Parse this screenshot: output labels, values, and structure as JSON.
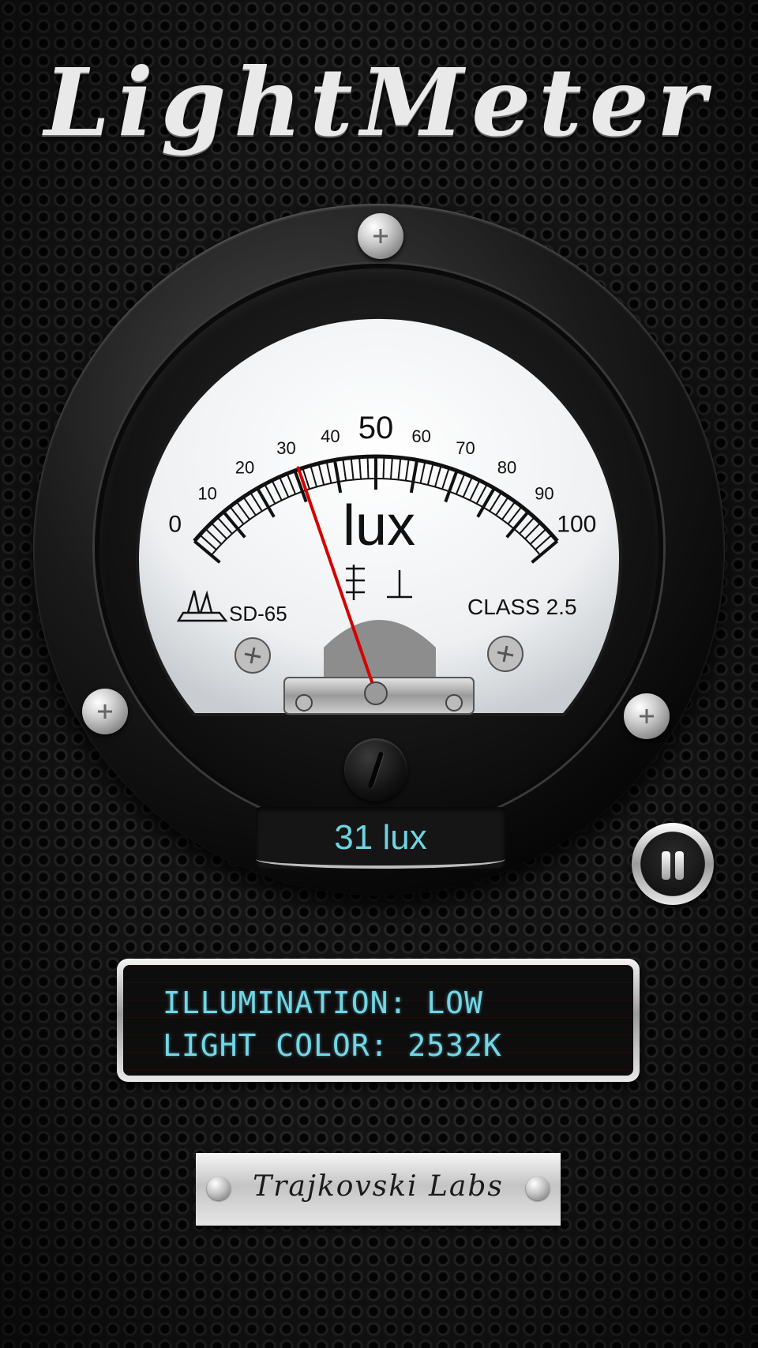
{
  "app": {
    "title": "LightMeter"
  },
  "gauge": {
    "scale_labels": [
      "0",
      "10",
      "20",
      "30",
      "40",
      "50",
      "60",
      "70",
      "80",
      "90",
      "100"
    ],
    "unit_label": "lux",
    "model_label": "SD-65",
    "class_label": "CLASS 2.5",
    "needle_value": 31,
    "scale_min": 0,
    "scale_max": 100,
    "needle_color": "#d40000"
  },
  "readout": {
    "value_text": "31 lux",
    "color": "#6fd3e0"
  },
  "controls": {
    "pause_icon": "pause-icon"
  },
  "info_panel": {
    "illumination_line": "ILLUMINATION: LOW",
    "light_color_line": "LIGHT COLOR: 2532K",
    "text_color": "#74d6e6"
  },
  "brand": {
    "name": "Trajkovski Labs"
  }
}
